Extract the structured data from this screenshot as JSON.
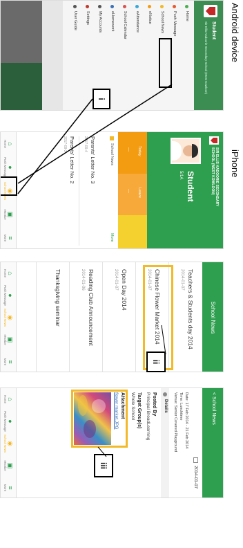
{
  "captions": {
    "android": "Android device",
    "iphone": "iPhone"
  },
  "callouts": [
    "i",
    "ii",
    "iii"
  ],
  "android": {
    "header_title": "Student",
    "header_subtitle": "Sir Ellis Kadoorie Secondary School (West Kowloon)",
    "menu": [
      {
        "label": "Home",
        "color": "#4caf50"
      },
      {
        "label": "Push Message",
        "color": "#e65a2c"
      },
      {
        "label": "School News",
        "color": "#f2b928"
      },
      {
        "label": "eNotice",
        "color": "#f39c12"
      },
      {
        "label": "eAttendance",
        "color": "#3aa7d9"
      },
      {
        "label": "School Calendar",
        "color": "#d9534f"
      },
      {
        "label": "eHomework",
        "color": "#3b6fb6"
      },
      {
        "label": "My Accounts",
        "color": "#555555"
      },
      {
        "label": "Settings",
        "color": "#c0392b"
      },
      {
        "label": "User Guide",
        "color": "#555555"
      }
    ]
  },
  "iphone1": {
    "school_name_line1": "SIR ELLIS KADOORIE SECONDARY",
    "school_name_line2": "SCHOOL (WEST KOWLOON)",
    "student_label": "Student",
    "class_label": "5/1A",
    "today_label": "Today",
    "leave_label": "Leave",
    "dash1": "---",
    "dash2": "---",
    "section_title": "School News",
    "more_label": "More",
    "news": [
      {
        "title": "Parents' Letter No. 3",
        "date": "2017-09-4"
      },
      {
        "title": "Parents' Letter No. 2",
        "date": "2017-09-2"
      }
    ]
  },
  "iphone2": {
    "title": "School News",
    "items": [
      {
        "title": "Teachers & Students day 2014",
        "date": "2014-01-07"
      },
      {
        "title": "Chinese Flower Market 2014",
        "date": "2014-01-07"
      },
      {
        "title": "Open Day 2014",
        "date": "2014-01-07"
      },
      {
        "title": "Reading Club Announcement",
        "date": "2014-01-06"
      },
      {
        "title": "Thanksgiving seminar",
        "date": ""
      }
    ]
  },
  "iphone3": {
    "back_label": "< School News",
    "date": "2014-01-07",
    "info_date": "Date: 17 Feb 2014 - 21 Feb 2014",
    "info_time": "Time: Lunchtime",
    "info_venue": "Venue: Senior Covered Playground",
    "details_label": "Details",
    "posted_by_label": "Posted By",
    "posted_by_value": "Principal BroadLearning",
    "target_label": "Target Group(s)",
    "target_value": "Whole School",
    "attachment_label": "Attachment",
    "attachment_file": "flower market.JPG"
  },
  "tabbar": [
    {
      "label": "Home",
      "icon": "home-icon"
    },
    {
      "label": "Push Message",
      "icon": "chat-icon"
    },
    {
      "label": "School News",
      "icon": "broadcast-icon"
    },
    {
      "label": "eNotice",
      "icon": "notice-icon"
    },
    {
      "label": "More",
      "icon": "menu-icon"
    }
  ],
  "colors": {
    "green": "#2e9e4f",
    "highlight": "#f2b928",
    "orange": "#f39c12",
    "yellow": "#f5d130"
  }
}
